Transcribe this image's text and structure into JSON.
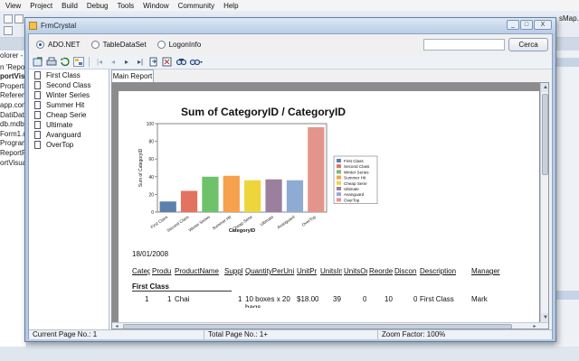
{
  "ide": {
    "menu": [
      "View",
      "Project",
      "Build",
      "Debug",
      "Tools",
      "Window",
      "Community",
      "Help"
    ],
    "toolbar_text": "sMap.ps",
    "sidebar_items": [
      "olorer - Re",
      "n 'Report",
      "portVisu",
      "Propertie",
      "Referenc",
      "app.conf",
      "DatiData",
      "db.mdb",
      "Form1.cs",
      "Program",
      "ReportPr",
      "ortVisua"
    ]
  },
  "window": {
    "title": "FrmCrystal",
    "minimize": "_",
    "maximize": "□",
    "close": "X"
  },
  "options": {
    "radios": [
      {
        "label": "ADO.NET",
        "selected": true
      },
      {
        "label": "TableDataSet",
        "selected": false
      },
      {
        "label": "LogonInfo",
        "selected": false
      }
    ],
    "search_value": "",
    "search_button": "Cerca"
  },
  "viewer_toolbar": {
    "icons": [
      "export-icon",
      "print-icon",
      "refresh-icon",
      "toggle-tree-icon",
      "first-page-icon",
      "prev-page-icon",
      "next-page-icon",
      "last-page-icon",
      "goto-page-icon",
      "close-view-icon",
      "find-icon",
      "zoom-icon"
    ]
  },
  "group_tree": {
    "items": [
      "First Class",
      "Second Class",
      "Winter Series",
      "Summer Hit",
      "Cheap Serie",
      "Ultimate",
      "Avanguard",
      "OverTop"
    ]
  },
  "report": {
    "tab_label": "Main Report",
    "date": "18/01/2008",
    "columns": [
      "Categ",
      "Produ",
      "ProductName",
      "Suppl",
      "QuantityPerUni",
      "UnitPr",
      "UnitsIn",
      "UnitsOn",
      "Reorde",
      "Discon",
      "Description",
      "Manager"
    ],
    "group_title": "First Class",
    "row": {
      "categ": "1",
      "prod": "1",
      "name": "Chai",
      "supp": "1",
      "qty": "10 boxes x 20",
      "qty2": "bags",
      "price": "$18.00",
      "instock": "39",
      "onorder": "0",
      "reorder": "10",
      "discon": "0",
      "desc": "First Class",
      "manager": "Mark"
    }
  },
  "chart_data": {
    "type": "bar",
    "title": "Sum of CategoryID / CategoryID",
    "xlabel": "CategoryID",
    "ylabel": "Sum of CategoryID",
    "ylim": [
      0,
      100
    ],
    "yticks": [
      0,
      20,
      40,
      60,
      80,
      100
    ],
    "grid": false,
    "legend_position": "right",
    "categories": [
      "First Class",
      "Second Class",
      "Winter Series",
      "Summer Hit",
      "Cheap Serie",
      "Ultimate",
      "Avanguard",
      "OverTop"
    ],
    "values": [
      12,
      24,
      40,
      41,
      36,
      37,
      36,
      96
    ],
    "colors": [
      "#5d7fab",
      "#e37261",
      "#6ec26a",
      "#f7a14c",
      "#eed53c",
      "#9b7f9f",
      "#8eabd4",
      "#e3958c"
    ]
  },
  "status": {
    "current_page": "Current Page No.: 1",
    "total_page": "Total Page No.: 1+",
    "zoom": "Zoom Factor: 100%"
  }
}
